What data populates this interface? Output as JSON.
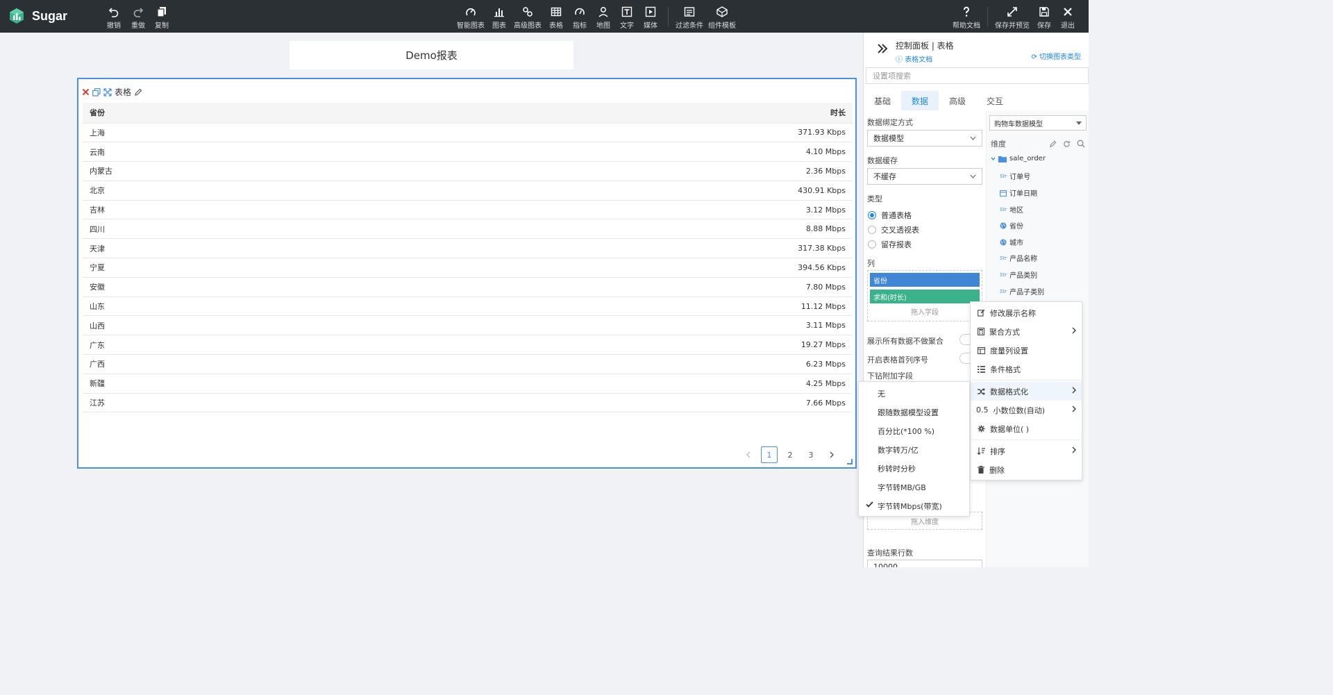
{
  "app": {
    "name": "Sugar"
  },
  "toolbar_left": [
    {
      "label": "撤销",
      "icon": "undo-icon"
    },
    {
      "label": "重做",
      "icon": "redo-icon"
    },
    {
      "label": "复制",
      "icon": "copy-icon"
    }
  ],
  "toolbar_center": [
    {
      "label": "智能图表",
      "icon": "smart-chart-icon"
    },
    {
      "label": "图表",
      "icon": "chart-icon"
    },
    {
      "label": "高级图表",
      "icon": "advanced-chart-icon"
    },
    {
      "label": "表格",
      "icon": "table-icon"
    },
    {
      "label": "指标",
      "icon": "gauge-icon"
    },
    {
      "label": "地图",
      "icon": "map-icon"
    },
    {
      "label": "文字",
      "icon": "text-icon"
    },
    {
      "label": "媒体",
      "icon": "media-icon"
    },
    {
      "label": "过滤条件",
      "icon": "filter-icon"
    },
    {
      "label": "组件模板",
      "icon": "template-icon"
    }
  ],
  "toolbar_right": [
    {
      "label": "帮助文档",
      "icon": "help-icon"
    },
    {
      "label": "保存并预览",
      "icon": "save-preview-icon"
    },
    {
      "label": "保存",
      "icon": "save-icon"
    },
    {
      "label": "退出",
      "icon": "exit-icon"
    }
  ],
  "report": {
    "title": "Demo报表"
  },
  "widget": {
    "name": "表格"
  },
  "table": {
    "headers": [
      "省份",
      "时长"
    ],
    "rows": [
      [
        "上海",
        "371.93 Kbps"
      ],
      [
        "云南",
        "4.10 Mbps"
      ],
      [
        "内蒙古",
        "2.36 Mbps"
      ],
      [
        "北京",
        "430.91 Kbps"
      ],
      [
        "吉林",
        "3.12 Mbps"
      ],
      [
        "四川",
        "8.88 Mbps"
      ],
      [
        "天津",
        "317.38 Kbps"
      ],
      [
        "宁夏",
        "394.56 Kbps"
      ],
      [
        "安徽",
        "7.80 Mbps"
      ],
      [
        "山东",
        "11.12 Mbps"
      ],
      [
        "山西",
        "3.11 Mbps"
      ],
      [
        "广东",
        "19.27 Mbps"
      ],
      [
        "广西",
        "6.23 Mbps"
      ],
      [
        "新疆",
        "4.25 Mbps"
      ],
      [
        "江苏",
        "7.66 Mbps"
      ]
    ]
  },
  "pagination": {
    "pages": [
      "1",
      "2",
      "3"
    ],
    "current": "1"
  },
  "panel": {
    "title": "控制面板 | 表格",
    "doc_link": "表格文档",
    "switch_link": "切换图表类型",
    "search_placeholder": "设置项搜索",
    "tabs": [
      "基础",
      "数据",
      "高级",
      "交互"
    ],
    "active_tab": "数据",
    "binding_label": "数据绑定方式",
    "binding_value": "数据模型",
    "cache_label": "数据缓存",
    "cache_value": "不缓存",
    "type_label": "类型",
    "types": [
      "普通表格",
      "交叉透视表",
      "留存报表"
    ],
    "selected_type": "普通表格",
    "columns_label": "列",
    "columns": [
      {
        "label": "省份",
        "color": "#3f86d6"
      },
      {
        "label": "求和(时长)",
        "color": "#3bb38a"
      }
    ],
    "drop_field": "拖入字段",
    "show_all_label": "展示所有数据不做聚合",
    "serial_label": "开启表格首列序号",
    "drill_label": "下钻附加字段",
    "drop_dim": "拖入维度",
    "rows_label": "查询结果行数",
    "rows_value": "10000"
  },
  "model": {
    "selected": "购物车数据模型",
    "dim_label": "维度",
    "folder": "sale_order",
    "fields": [
      {
        "type": "Str",
        "name": "订单号"
      },
      {
        "type": "date",
        "name": "订单日期"
      },
      {
        "type": "Str",
        "name": "地区"
      },
      {
        "type": "geo",
        "name": "省份"
      },
      {
        "type": "geo",
        "name": "城市"
      },
      {
        "type": "Str",
        "name": "产品名称"
      },
      {
        "type": "Str",
        "name": "产品类别"
      },
      {
        "type": "Str",
        "name": "产品子类别"
      }
    ]
  },
  "context_menu": [
    {
      "label": "修改展示名称",
      "icon": "edit-icon"
    },
    {
      "label": "聚合方式",
      "icon": "calculator-icon",
      "arrow": true
    },
    {
      "label": "度量列设置",
      "icon": "columns-icon"
    },
    {
      "label": "条件格式",
      "icon": "list-icon"
    },
    {
      "label": "数据格式化",
      "icon": "shuffle-icon",
      "arrow": true
    },
    {
      "label": "小数位数(自动)",
      "icon": "decimal-icon",
      "prefix": "0.5",
      "arrow": true
    },
    {
      "label": "数据单位( )",
      "icon": "gear-icon"
    },
    {
      "label": "排序",
      "icon": "sort-icon",
      "arrow": true
    },
    {
      "label": "删除",
      "icon": "trash-icon"
    }
  ],
  "format_menu": {
    "items": [
      "无",
      "跟随数据模型设置",
      "百分比(*100 %)",
      "数字转万/亿",
      "秒转时分秒",
      "字节转MB/GB",
      "字节转Mbps(带宽)"
    ],
    "selected": "字节转Mbps(带宽)"
  },
  "colors": {
    "topbar": "#2b3035",
    "accent": "#4a90e2",
    "link": "#1e88e5",
    "chip_blue": "#3f86d6",
    "chip_green": "#3bb38a",
    "close_red": "#e53935"
  }
}
